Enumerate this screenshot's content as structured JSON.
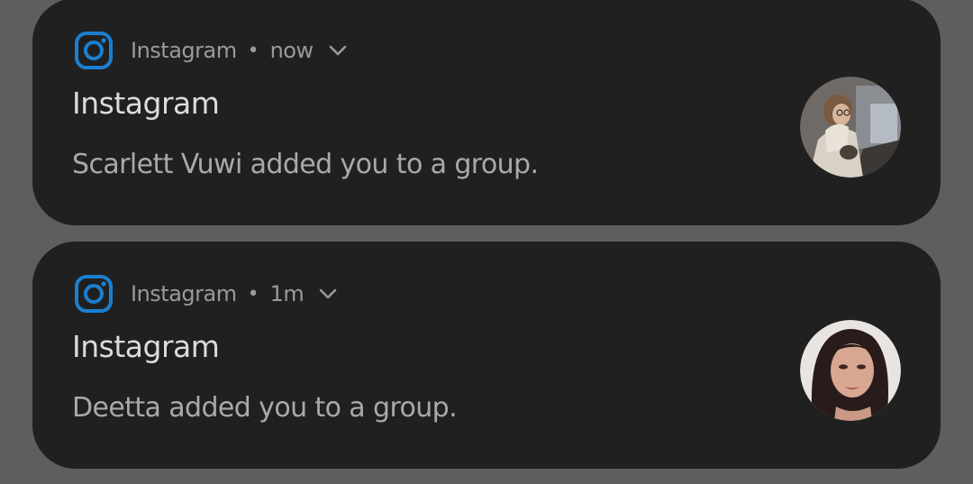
{
  "colors": {
    "background": "#5e5e5e",
    "card": "#202020",
    "instagram_blue": "#1b7fcf",
    "meta_text": "#9a9a9a",
    "title_text": "#dcdcdc",
    "body_text": "#a9a9a9"
  },
  "notifications": [
    {
      "app_icon": "instagram-icon",
      "app_name": "Instagram",
      "separator": "•",
      "time": "now",
      "expand_icon": "chevron-down-icon",
      "title": "Instagram",
      "message": "Scarlett Vuwi added you to a group.",
      "avatar": "profile-photo"
    },
    {
      "app_icon": "instagram-icon",
      "app_name": "Instagram",
      "separator": "•",
      "time": "1m",
      "expand_icon": "chevron-down-icon",
      "title": "Instagram",
      "message": "Deetta added you to a group.",
      "avatar": "profile-photo"
    }
  ]
}
